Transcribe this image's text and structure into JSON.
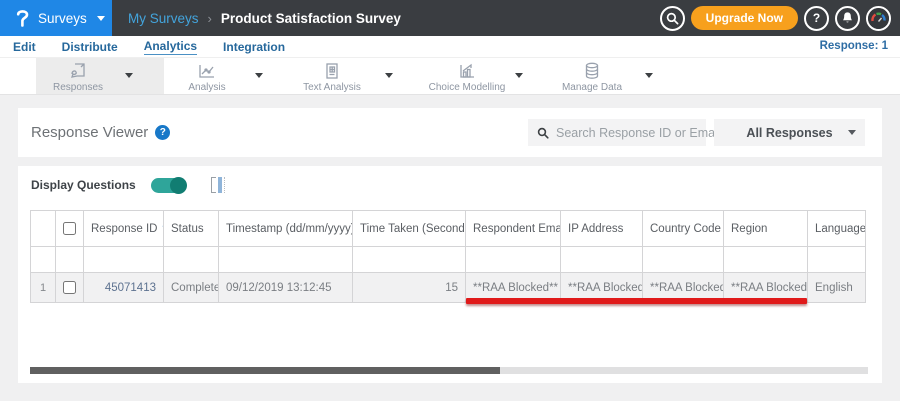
{
  "header": {
    "product_label": "Surveys",
    "breadcrumb": {
      "parent": "My Surveys",
      "separator": "›",
      "current": "Product Satisfaction Survey"
    },
    "upgrade_label": "Upgrade Now",
    "help_glyph": "?"
  },
  "tabs": {
    "items": [
      {
        "label": "Edit"
      },
      {
        "label": "Distribute"
      },
      {
        "label": "Analytics"
      },
      {
        "label": "Integration"
      }
    ],
    "active": "Analytics",
    "response_count_label": "Response: 1"
  },
  "toolbar": {
    "items": [
      {
        "label": "Responses",
        "icon": "responses-icon",
        "active": true
      },
      {
        "label": "Analysis",
        "icon": "line-chart-icon",
        "active": false
      },
      {
        "label": "Text Analysis",
        "icon": "document-grid-icon",
        "active": false
      },
      {
        "label": "Choice Modelling",
        "icon": "bar-chart-icon",
        "active": false
      },
      {
        "label": "Manage Data",
        "icon": "database-icon",
        "active": false
      }
    ]
  },
  "response_viewer": {
    "title": "Response Viewer",
    "help_glyph": "?",
    "search_placeholder": "Search Response ID or Email",
    "filter_selected": "All Responses"
  },
  "controls": {
    "display_questions_label": "Display Questions",
    "toggle_state": "on"
  },
  "table": {
    "sort_desc_glyph": "▾",
    "sort_both_glyph": "⇅",
    "columns": [
      {
        "label": ""
      },
      {
        "label": ""
      },
      {
        "label": "Response ID",
        "sort": "desc"
      },
      {
        "label": "Status"
      },
      {
        "label": "Timestamp (dd/mm/yyyy)",
        "sort": "both"
      },
      {
        "label": "Time Taken (Seconds)",
        "sort": "both"
      },
      {
        "label": "Respondent Email"
      },
      {
        "label": "IP Address"
      },
      {
        "label": "Country Code"
      },
      {
        "label": "Region"
      },
      {
        "label": "Language"
      }
    ],
    "rows": [
      {
        "num": "1",
        "response_id": "45071413",
        "status": "Completed",
        "timestamp": "09/12/2019 13:12:45",
        "time_taken": "15",
        "respondent_email": "**RAA Blocked**",
        "ip_address": "**RAA Blocked**",
        "country_code": "**RAA Blocked**",
        "region": "**RAA Blocked**",
        "language": "English"
      }
    ]
  },
  "colors": {
    "header_bg": "#3a3d41",
    "brand_blue": "#1f87e6",
    "link_blue": "#26689c",
    "upgrade_orange": "#f7a01d",
    "toggle_teal": "#2fa59a",
    "annotation_red": "#e01a1a",
    "row_bg": "#f1f1f2"
  }
}
